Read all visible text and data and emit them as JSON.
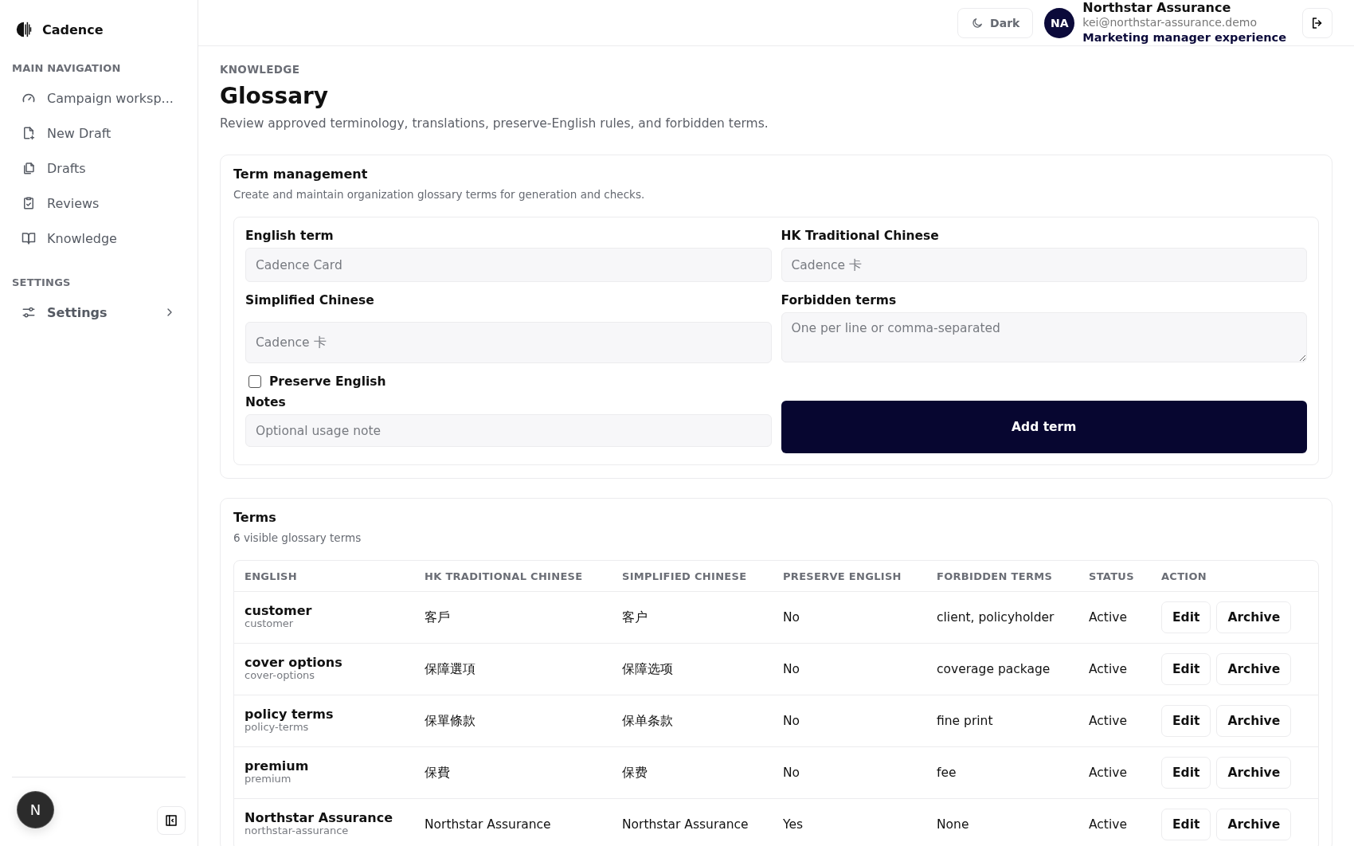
{
  "brand": {
    "name": "Cadence"
  },
  "sidebar": {
    "sections": [
      {
        "title": "MAIN NAVIGATION",
        "items": [
          {
            "label": "Campaign worksp...",
            "kind": "link",
            "selected": false
          },
          {
            "label": "New Draft",
            "kind": "link",
            "selected": false
          },
          {
            "label": "Drafts",
            "kind": "link",
            "selected": false
          },
          {
            "label": "Reviews",
            "kind": "link",
            "selected": false
          },
          {
            "label": "Knowledge",
            "kind": "link",
            "selected": false
          }
        ]
      },
      {
        "title": "SETTINGS",
        "items": [
          {
            "label": "Settings",
            "kind": "group",
            "selected": false
          }
        ]
      }
    ],
    "user_initial": "N"
  },
  "header": {
    "theme_button": "Dark",
    "account": {
      "initials": "NA",
      "name": "Northstar Assurance",
      "email": "kei@northstar-assurance.demo",
      "role": "Marketing manager experience"
    }
  },
  "page": {
    "eyebrow": "KNOWLEDGE",
    "title": "Glossary",
    "description": "Review approved terminology, translations, preserve-English rules, and forbidden terms."
  },
  "term_form": {
    "title": "Term management",
    "subtitle": "Create and maintain organization glossary terms for generation and checks.",
    "english": {
      "label": "English term",
      "placeholder": "Cadence Card"
    },
    "hk_traditional": {
      "label": "HK Traditional Chinese",
      "placeholder": "Cadence 卡"
    },
    "simplified": {
      "label": "Simplified Chinese",
      "placeholder": "Cadence 卡"
    },
    "forbidden": {
      "label": "Forbidden terms",
      "placeholder": "One per line or comma-separated"
    },
    "preserve_english": {
      "label": "Preserve English",
      "checked": false
    },
    "notes": {
      "label": "Notes",
      "placeholder": "Optional usage note"
    },
    "submit": "Add term"
  },
  "terms": {
    "title": "Terms",
    "subtitle": "6 visible glossary terms",
    "columns": [
      "ENGLISH",
      "HK TRADITIONAL CHINESE",
      "SIMPLIFIED CHINESE",
      "PRESERVE ENGLISH",
      "FORBIDDEN TERMS",
      "STATUS",
      "ACTION"
    ],
    "rows": [
      {
        "english": "customer",
        "slug": "customer",
        "hk": "客戶",
        "sc": "客户",
        "preserve": "No",
        "forbidden": "client, policyholder",
        "status": "Active",
        "actions": [
          "Edit",
          "Archive"
        ]
      },
      {
        "english": "cover options",
        "slug": "cover-options",
        "hk": "保障選項",
        "sc": "保障选项",
        "preserve": "No",
        "forbidden": "coverage package",
        "status": "Active",
        "actions": [
          "Edit",
          "Archive"
        ]
      },
      {
        "english": "policy terms",
        "slug": "policy-terms",
        "hk": "保單條款",
        "sc": "保单条款",
        "preserve": "No",
        "forbidden": "fine print",
        "status": "Active",
        "actions": [
          "Edit",
          "Archive"
        ]
      },
      {
        "english": "premium",
        "slug": "premium",
        "hk": "保費",
        "sc": "保费",
        "preserve": "No",
        "forbidden": "fee",
        "status": "Active",
        "actions": [
          "Edit",
          "Archive"
        ]
      },
      {
        "english": "Northstar Assurance",
        "slug": "northstar-assurance",
        "hk": "Northstar Assurance",
        "sc": "Northstar Assurance",
        "preserve": "Yes",
        "forbidden": "None",
        "status": "Active",
        "actions": [
          "Edit",
          "Archive"
        ]
      }
    ]
  }
}
